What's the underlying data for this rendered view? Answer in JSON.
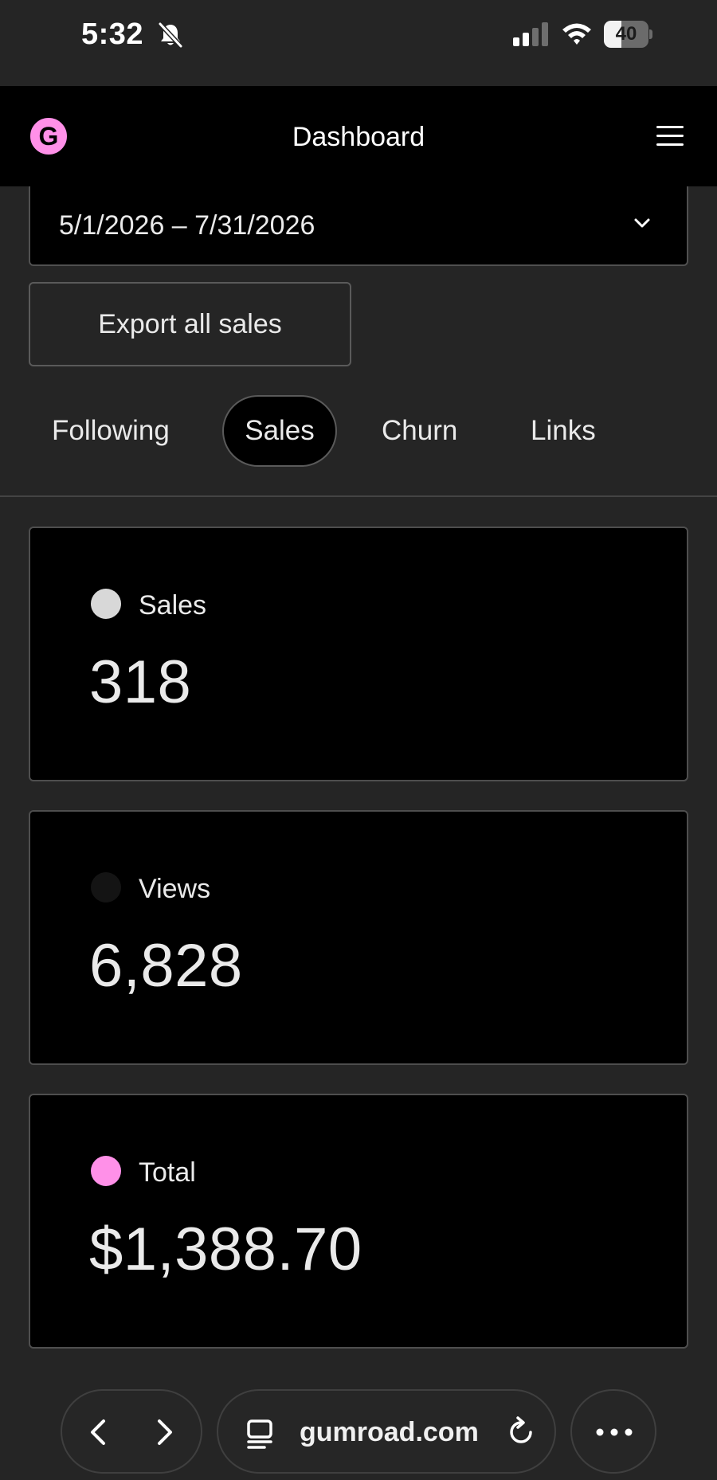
{
  "status_bar": {
    "time": "5:32",
    "battery_level": "40",
    "battery_fraction": 0.4,
    "icons": [
      "bell-slash-icon",
      "signal-icon",
      "wifi-icon",
      "battery-icon"
    ]
  },
  "header": {
    "logo_letter": "G",
    "title": "Dashboard",
    "menu_icon": "hamburger-menu-icon"
  },
  "date_range": {
    "value": "5/1/2026 – 7/31/2026",
    "icon": "chevron-down-icon"
  },
  "export_button": "Export all sales",
  "tabs": [
    {
      "label": "Following",
      "active": false
    },
    {
      "label": "Sales",
      "active": true
    },
    {
      "label": "Churn",
      "active": false
    },
    {
      "label": "Links",
      "active": false
    }
  ],
  "cards": [
    {
      "label": "Sales",
      "value": "318",
      "dot_color": "#d8d8d8"
    },
    {
      "label": "Views",
      "value": "6,828",
      "dot_color": "#141414"
    },
    {
      "label": "Total",
      "value": "$1,388.70",
      "dot_color": "#ff90e8"
    }
  ],
  "browser_bar": {
    "url": "gumroad.com",
    "icons": [
      "back-arrow-icon",
      "forward-arrow-icon",
      "tabs-icon",
      "reload-icon",
      "more-icon"
    ]
  },
  "colors": {
    "background": "#252525",
    "surface": "#000000",
    "accent": "#ff90e8",
    "text": "#eaeaea"
  }
}
